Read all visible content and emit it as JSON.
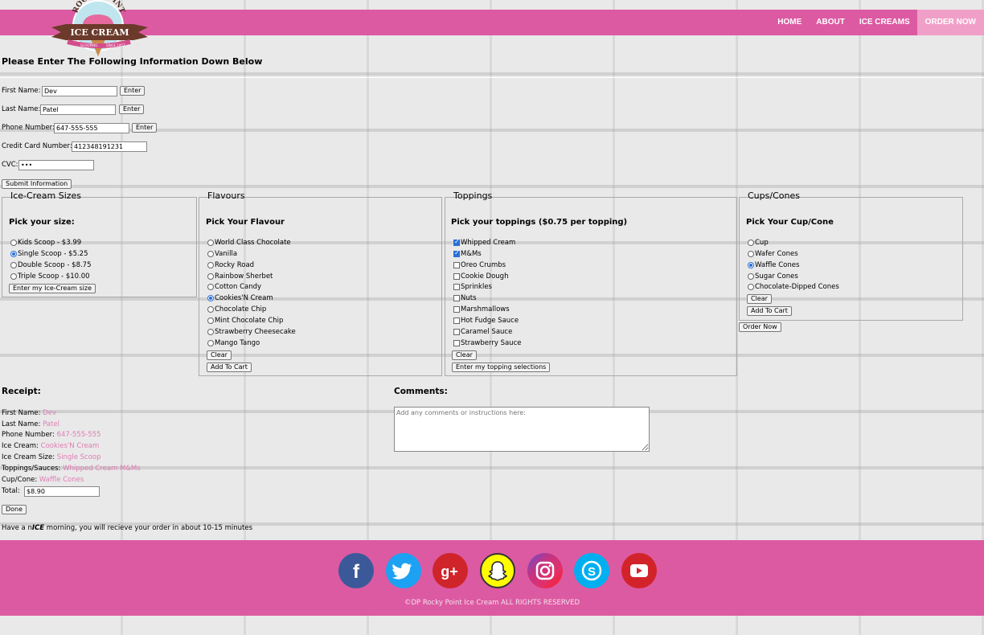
{
  "nav": {
    "links": [
      "HOME",
      "ABOUT",
      "ICE CREAMS",
      "ORDER NOW"
    ],
    "logo": {
      "line1": "ROCKY POINT",
      "line2": "ICE CREAM",
      "tag1": "SCOOPING",
      "tag2": "SINCE 1957"
    }
  },
  "heading": "Please Enter The Following Information Down Below",
  "form": {
    "first_label": "First Name:",
    "first_value": "Dev",
    "last_label": "Last Name:",
    "last_value": "Patel",
    "phone_label": "Phone Number:",
    "phone_value": "647-555-555",
    "cc_label": "Credit Card Number:",
    "cc_value": "412348191231",
    "cvc_label": "CVC:",
    "cvc_value": "•••",
    "enter": "Enter",
    "submit": "Submit Information"
  },
  "sizes": {
    "legend": "Ice-Cream Sizes",
    "heading": "Pick your size:",
    "options": [
      "Kids Scoop - $3.99",
      "Single Scoop - $5.25",
      "Double Scoop - $8.75",
      "Triple Scoop - $10.00"
    ],
    "selected": 1,
    "button": "Enter my Ice-Cream size"
  },
  "flavours": {
    "legend": "Flavours",
    "heading": "Pick Your Flavour",
    "options": [
      "World Class Chocolate",
      "Vanilla",
      "Rocky Road",
      "Rainbow Sherbet",
      "Cotton Candy",
      "Cookies'N Cream",
      "Chocolate Chip",
      "Mint Chocolate Chip",
      "Strawberry Cheesecake",
      "Mango Tango"
    ],
    "selected": 5,
    "clear": "Clear",
    "add": "Add To Cart"
  },
  "toppings": {
    "legend": "Toppings",
    "heading": "Pick your toppings ($0.75 per topping)",
    "options": [
      "Whipped Cream",
      "M&Ms",
      "Oreo Crumbs",
      "Cookie Dough",
      "Sprinkles",
      "Nuts",
      "Marshmallows",
      "Hot Fudge Sauce",
      "Caramel Sauce",
      "Strawberry Sauce"
    ],
    "checked": [
      true,
      true,
      false,
      false,
      false,
      false,
      false,
      false,
      false,
      false
    ],
    "clear": "Clear",
    "enter": "Enter my topping selections"
  },
  "cups": {
    "legend": "Cups/Cones",
    "heading": "Pick Your Cup/Cone",
    "options": [
      "Cup",
      "Wafer Cones",
      "Waffle Cones",
      "Sugar Cones",
      "Chocolate-Dipped Cones"
    ],
    "selected": 2,
    "clear": "Clear",
    "add": "Add To Cart",
    "order": "Order Now"
  },
  "receipt": {
    "title": "Receipt:",
    "first_label": "First Name:",
    "first": "Dev",
    "last_label": "Last Name:",
    "last": "Patel",
    "phone_label": "Phone Number:",
    "phone": "647-555-555",
    "ice_label": "Ice Cream:",
    "ice": "Cookies'N Cream",
    "size_label": "Ice Cream Size:",
    "size": "Single Scoop",
    "top_label": "Toppings/Sauces:",
    "top": "Whipped Cream M&Ms",
    "cup_label": "Cup/Cone:",
    "cup": "Waffle Cones",
    "total_label": "Total:",
    "total": "$8.90",
    "done": "Done",
    "msg_pre": "Have a n",
    "msg_em": "ICE",
    "msg_post": " morning, you will recieve your order in about 10-15 minutes"
  },
  "comments": {
    "title": "Comments:",
    "placeholder": "Add any comments or instructions here:"
  },
  "footer": {
    "social": [
      "facebook-icon",
      "twitter-icon",
      "google-plus-icon",
      "snapchat-icon",
      "instagram-icon",
      "skype-icon",
      "youtube-icon"
    ],
    "copyright": "©DP Rocky Point Ice Cream ALL RIGHTS RESERVED"
  },
  "colors": {
    "brand": "#dc5aa2",
    "accent_text": "#e07cb4"
  }
}
